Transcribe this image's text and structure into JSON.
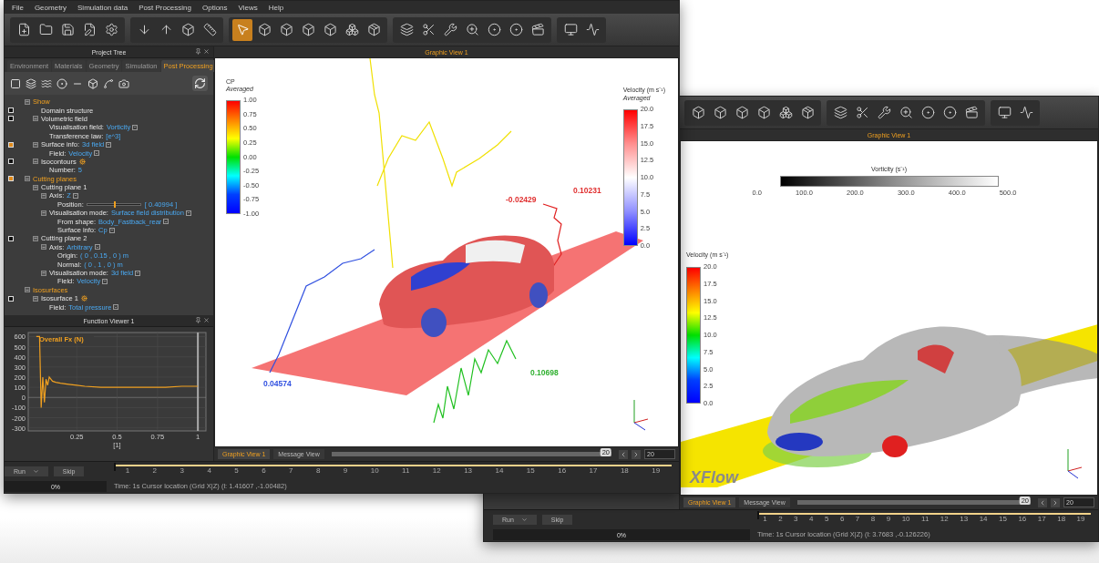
{
  "menu": [
    "File",
    "Geometry",
    "Simulation data",
    "Post Processing",
    "Options",
    "Views",
    "Help"
  ],
  "main_window": {
    "toolbar": [
      [
        {
          "selected": false
        },
        {
          "selected": false
        },
        {
          "selected": false
        },
        {
          "selected": false
        },
        {
          "selected": false
        }
      ],
      [
        {
          "selected": false
        },
        {
          "selected": false
        },
        {
          "selected": false
        },
        {
          "selected": false
        }
      ],
      [
        {
          "selected": true
        },
        {
          "selected": false
        },
        {
          "selected": false
        },
        {
          "selected": false
        },
        {
          "selected": false
        },
        {
          "selected": false
        },
        {
          "selected": false
        }
      ],
      [
        {
          "selected": false
        },
        {
          "selected": false
        },
        {
          "selected": false
        },
        {
          "selected": false
        },
        {
          "selected": false
        },
        {
          "selected": false
        },
        {
          "selected": false
        }
      ],
      [
        {
          "selected": false
        },
        {
          "selected": false
        }
      ]
    ],
    "project_tree": {
      "title": "Project Tree",
      "tabs": [
        {
          "label": "Environment",
          "selected": false
        },
        {
          "label": "Materials",
          "selected": false
        },
        {
          "label": "Geometry",
          "selected": false
        },
        {
          "label": "Simulation",
          "selected": false
        },
        {
          "label": "Post Processing",
          "selected": true
        }
      ],
      "nodes": [
        {
          "label": "Show",
          "kind": "group",
          "expanded": true,
          "children": [
            {
              "label": "Domain structure",
              "kind": "node",
              "checked": false
            },
            {
              "label": "Volumetric field",
              "kind": "node",
              "checked": false,
              "expanded": true,
              "children": [
                {
                  "label": "Visualisation field:",
                  "kind": "choice",
                  "value": "Vorticity"
                },
                {
                  "label": "Transference law:",
                  "kind": "value",
                  "value": "[e^3]"
                }
              ]
            },
            {
              "label": "Surface info:",
              "kind": "choice",
              "value": "3d field",
              "checked": true,
              "expanded": true,
              "children": [
                {
                  "label": "Field:",
                  "kind": "choice",
                  "value": "Velocity"
                }
              ]
            },
            {
              "label": "Isocontours",
              "kind": "setting",
              "checked": false,
              "expanded": true,
              "children": [
                {
                  "label": "Number:",
                  "kind": "value",
                  "value": "5"
                }
              ]
            }
          ]
        },
        {
          "label": "Cutting planes",
          "kind": "group",
          "checked": true,
          "expanded": true,
          "children": [
            {
              "label": "Cutting plane 1",
              "kind": "node",
              "expanded": true,
              "children": [
                {
                  "label": "Axis:",
                  "kind": "choice",
                  "value": "Z",
                  "expanded": true,
                  "children": [
                    {
                      "label": "Position:",
                      "kind": "slider",
                      "value": "[ 0.40994 ]",
                      "level": 0.5
                    }
                  ]
                },
                {
                  "label": "Visualisation mode:",
                  "kind": "choice",
                  "value": "Surface field distribution",
                  "expanded": true,
                  "children": [
                    {
                      "label": "From shape:",
                      "kind": "choice",
                      "value": "Body_Fastback_rear"
                    },
                    {
                      "label": "Surface info:",
                      "kind": "choice",
                      "value": "Cp"
                    }
                  ]
                }
              ]
            },
            {
              "label": "Cutting plane 2",
              "kind": "node",
              "checked": false,
              "expanded": true,
              "children": [
                {
                  "label": "Axis:",
                  "kind": "choice",
                  "value": "Arbitrary",
                  "expanded": true,
                  "children": [
                    {
                      "label": "Origin:",
                      "kind": "value",
                      "value": "( 0 , 0.15 , 0 ) m"
                    },
                    {
                      "label": "Normal:",
                      "kind": "value",
                      "value": "( 0 , 1 , 0 ) m"
                    }
                  ]
                },
                {
                  "label": "Visualisation mode:",
                  "kind": "choice",
                  "value": "3d field",
                  "expanded": true,
                  "children": [
                    {
                      "label": "Field:",
                      "kind": "choice",
                      "value": "Velocity"
                    }
                  ]
                }
              ]
            }
          ]
        },
        {
          "label": "Isosurfaces",
          "kind": "group",
          "expanded": true,
          "children": [
            {
              "label": "Isosurface 1",
              "kind": "setting",
              "checked": false,
              "expanded": true,
              "children": [
                {
                  "label": "Field:",
                  "kind": "choice",
                  "value": "Total pressure"
                }
              ]
            }
          ]
        }
      ]
    },
    "function_viewer": {
      "title": "Function Viewer 1",
      "chart_data": {
        "type": "line",
        "grid": true,
        "xlabel": "[1]",
        "xlim": [
          -0.05,
          1.05
        ],
        "ylim": [
          -330,
          640
        ],
        "ref_lines": [
          {
            "axis": "x",
            "value": 1,
            "color": "#aaaaaa"
          }
        ],
        "xticks": [
          0.25,
          0.5,
          0.75,
          1
        ],
        "yticks": [
          -300,
          -200,
          -100,
          0,
          100,
          200,
          300,
          400,
          500,
          600
        ],
        "x": [
          0,
          0.02,
          0.03,
          0.04,
          0.05,
          0.06,
          0.07,
          0.08,
          0.1,
          0.12,
          0.15,
          0.2,
          0.25,
          0.3,
          0.4,
          0.5,
          0.6,
          0.7,
          0.8,
          0.9,
          0.95,
          1.0
        ],
        "series": [
          {
            "name": "Overall Fx (N)",
            "color": "#f0a020",
            "values": [
              600,
              600,
              -100,
              200,
              -50,
              180,
              120,
              200,
              160,
              150,
              140,
              130,
              120,
              110,
              100,
              100,
              100,
              100,
              100,
              110,
              110,
              110
            ]
          }
        ]
      }
    },
    "graphic_view": {
      "title": "Graphic View 1",
      "cp_legend": {
        "title": "CP",
        "subtitle": "Averaged",
        "kind": "rainbow",
        "ticks": [
          "1.00",
          "0.75",
          "0.50",
          "0.25",
          "0.00",
          "-0.25",
          "-0.50",
          "-0.75",
          "-1.00"
        ]
      },
      "velocity_legend": {
        "title": "Velocity (m s⁻¹)",
        "subtitle": "Averaged",
        "kind": "diverging",
        "ticks": [
          "20.0",
          "17.5",
          "15.0",
          "12.5",
          "10.0",
          "7.5",
          "5.0",
          "2.5",
          "0.0"
        ]
      },
      "probe_labels": [
        {
          "text": "0.10231",
          "color": "#e03030"
        },
        {
          "text": "-0.02429",
          "color": "#e03030"
        },
        {
          "text": "0.04574",
          "color": "#3050e0"
        },
        {
          "text": "0.10698",
          "color": "#30b030"
        }
      ]
    },
    "view_tabs": [
      {
        "label": "Graphic View 1",
        "selected": true
      },
      {
        "label": "Message View",
        "selected": false
      }
    ],
    "view_scroll": {
      "label": "20",
      "level": 1
    },
    "frame": "20",
    "timeline": {
      "ticks": [
        "1",
        "2",
        "3",
        "4",
        "5",
        "6",
        "7",
        "8",
        "9",
        "10",
        "11",
        "12",
        "13",
        "14",
        "15",
        "16",
        "17",
        "18",
        "19"
      ],
      "level": 0
    },
    "run": {
      "label": "Run",
      "skip": "Skip",
      "progress": "0%",
      "level": 0
    },
    "status": "Time: 1s Cursor location (Grid X|Z) (l: 1.41607 ,-1.00482)"
  },
  "second_window": {
    "toolbar": [
      [
        {
          "selected": false
        },
        {
          "selected": false
        },
        {
          "selected": false
        },
        {
          "selected": false
        },
        {
          "selected": false
        },
        {
          "selected": false
        }
      ],
      [
        {
          "selected": false
        },
        {
          "selected": false
        },
        {
          "selected": false
        },
        {
          "selected": false
        },
        {
          "selected": false
        },
        {
          "selected": false
        },
        {
          "selected": false
        }
      ],
      [
        {
          "selected": false
        },
        {
          "selected": false
        }
      ]
    ],
    "graphic_view": {
      "title": "Graphic View 1",
      "vorticity_legend": {
        "title": "Vorticity (s⁻¹)",
        "kind": "grayscale",
        "ticks": [
          "0.0",
          "100.0",
          "200.0",
          "300.0",
          "400.0",
          "500.0"
        ]
      },
      "velocity_legend": {
        "title": "Velocity (m s⁻¹)",
        "kind": "rainbow",
        "ticks": [
          "20.0",
          "17.5",
          "15.0",
          "12.5",
          "10.0",
          "7.5",
          "5.0",
          "2.5",
          "0.0"
        ]
      },
      "logo": "XFlow"
    },
    "view_tabs": [
      {
        "label": "Graphic View 1",
        "selected": true
      },
      {
        "label": "Message View",
        "selected": false
      }
    ],
    "view_scroll": {
      "label": "20",
      "level": 1
    },
    "frame": "20",
    "timeline": {
      "ticks": [
        "1",
        "2",
        "3",
        "4",
        "5",
        "6",
        "7",
        "8",
        "9",
        "10",
        "11",
        "12",
        "13",
        "14",
        "15",
        "16",
        "17",
        "18",
        "19"
      ],
      "level": 0
    },
    "run": {
      "label": "Run",
      "skip": "Skip",
      "progress": "0%",
      "level": 0
    },
    "status": "Time: 1s Cursor location (Grid X|Z) (l: 3.7683 ,-0.126226)"
  }
}
